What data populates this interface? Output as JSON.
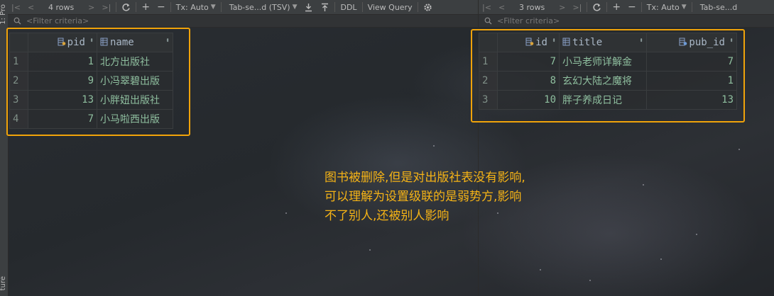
{
  "sidebar": {
    "label_top": "1: Pro",
    "label_bottom": "ture"
  },
  "left_pane": {
    "toolbar": {
      "rows": "4 rows",
      "tx": "Tx: Auto",
      "tab": "Tab-se...d (TSV)",
      "ddl": "DDL",
      "view_query": "View Query"
    },
    "filter_placeholder": "<Filter criteria>",
    "table": {
      "columns": [
        "pid",
        "name"
      ],
      "rows": [
        {
          "n": "1",
          "pid": "1",
          "name": "北方出版社"
        },
        {
          "n": "2",
          "pid": "9",
          "name": "小冯翠碧出版"
        },
        {
          "n": "3",
          "pid": "13",
          "name": "小胖妞出版社"
        },
        {
          "n": "4",
          "pid": "7",
          "name": "小马啦西出版"
        }
      ]
    }
  },
  "right_pane": {
    "toolbar": {
      "rows": "3 rows",
      "tx": "Tx: Auto",
      "tab": "Tab-se...d"
    },
    "filter_placeholder": "<Filter criteria>",
    "table": {
      "columns": [
        "id",
        "title",
        "pub_id"
      ],
      "rows": [
        {
          "n": "1",
          "id": "7",
          "title": "小马老师详解金",
          "pub_id": "7"
        },
        {
          "n": "2",
          "id": "8",
          "title": "玄幻大陆之魔将",
          "pub_id": "1"
        },
        {
          "n": "3",
          "id": "10",
          "title": "胖子养成日记",
          "pub_id": "13"
        }
      ]
    }
  },
  "annotation": {
    "lines": [
      "图书被删除,但是对出版社表没有影响,",
      "可以理解为设置级联的是弱势方,影响",
      "不了别人,还被别人影响"
    ]
  },
  "colors": {
    "highlight": "#f0a30a",
    "annotation": "#f5b316",
    "cell_text": "#8fbf9f"
  }
}
